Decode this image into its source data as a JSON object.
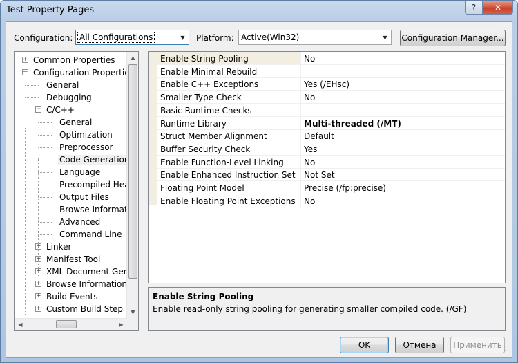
{
  "window": {
    "title": "Test Property Pages",
    "help_glyph": "?",
    "close_glyph": "✕"
  },
  "config_row": {
    "configuration_label": "Configuration:",
    "configuration_value": "All Configurations",
    "platform_label": "Platform:",
    "platform_value": "Active(Win32)",
    "manager_button": "Configuration Manager..."
  },
  "tree": {
    "items": [
      {
        "label": "Common Properties",
        "level": 0,
        "expander": "+"
      },
      {
        "label": "Configuration Properties",
        "level": 0,
        "expander": "−"
      },
      {
        "label": "General",
        "level": 1,
        "expander": ""
      },
      {
        "label": "Debugging",
        "level": 1,
        "expander": ""
      },
      {
        "label": "C/C++",
        "level": 1,
        "expander": "−"
      },
      {
        "label": "General",
        "level": 2,
        "expander": ""
      },
      {
        "label": "Optimization",
        "level": 2,
        "expander": ""
      },
      {
        "label": "Preprocessor",
        "level": 2,
        "expander": ""
      },
      {
        "label": "Code Generation",
        "level": 2,
        "expander": "",
        "selected": true
      },
      {
        "label": "Language",
        "level": 2,
        "expander": ""
      },
      {
        "label": "Precompiled Heade",
        "level": 2,
        "expander": ""
      },
      {
        "label": "Output Files",
        "level": 2,
        "expander": ""
      },
      {
        "label": "Browse Information",
        "level": 2,
        "expander": ""
      },
      {
        "label": "Advanced",
        "level": 2,
        "expander": ""
      },
      {
        "label": "Command Line",
        "level": 2,
        "expander": ""
      },
      {
        "label": "Linker",
        "level": 1,
        "expander": "+"
      },
      {
        "label": "Manifest Tool",
        "level": 1,
        "expander": "+"
      },
      {
        "label": "XML Document Genera",
        "level": 1,
        "expander": "+"
      },
      {
        "label": "Browse Information",
        "level": 1,
        "expander": "+"
      },
      {
        "label": "Build Events",
        "level": 1,
        "expander": "+"
      },
      {
        "label": "Custom Build Step",
        "level": 1,
        "expander": "+"
      }
    ]
  },
  "properties": {
    "rows": [
      {
        "name": "Enable String Pooling",
        "value": "No",
        "selected": true
      },
      {
        "name": "Enable Minimal Rebuild",
        "value": ""
      },
      {
        "name": "Enable C++ Exceptions",
        "value": "Yes (/EHsc)"
      },
      {
        "name": "Smaller Type Check",
        "value": "No"
      },
      {
        "name": "Basic Runtime Checks",
        "value": ""
      },
      {
        "name": "Runtime Library",
        "value": "Multi-threaded (/MT)",
        "bold": true
      },
      {
        "name": "Struct Member Alignment",
        "value": "Default"
      },
      {
        "name": "Buffer Security Check",
        "value": "Yes"
      },
      {
        "name": "Enable Function-Level Linking",
        "value": "No"
      },
      {
        "name": "Enable Enhanced Instruction Set",
        "value": "Not Set"
      },
      {
        "name": "Floating Point Model",
        "value": "Precise (/fp:precise)"
      },
      {
        "name": "Enable Floating Point Exceptions",
        "value": "No"
      }
    ]
  },
  "description": {
    "title": "Enable String Pooling",
    "body": "Enable read-only string pooling for generating smaller compiled code.     (/GF)"
  },
  "buttons": {
    "ok": "OK",
    "cancel": "Отмена",
    "apply": "Применить"
  }
}
